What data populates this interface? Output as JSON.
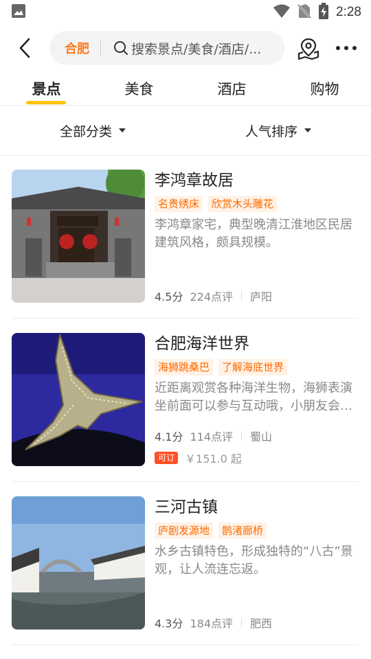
{
  "status_bar": {
    "time": "2:28"
  },
  "header": {
    "city": "合肥",
    "search_placeholder": "搜索景点/美食/酒店/..."
  },
  "tabs": [
    {
      "label": "景点",
      "active": true
    },
    {
      "label": "美食",
      "active": false
    },
    {
      "label": "酒店",
      "active": false
    },
    {
      "label": "购物",
      "active": false
    }
  ],
  "filters": {
    "category": "全部分类",
    "sort": "人气排序"
  },
  "items": [
    {
      "title": "李鸿章故居",
      "tags": [
        "名贵绣床",
        "欣赏木头雕花"
      ],
      "description": "李鸿章家宅，典型晚清江淮地区民居建筑风格，颇具规模。",
      "score": "4.5分",
      "reviews": "224点评",
      "district": "庐阳"
    },
    {
      "title": "合肥海洋世界",
      "tags": [
        "海狮跳桑巴",
        "了解海底世界"
      ],
      "description": "近距离观赏各种海洋生物，海狮表演坐前面可以参与互动哦，小朋友会很喜欢。",
      "score": "4.1分",
      "reviews": "114点评",
      "district": "蜀山",
      "badge": "可订",
      "price": "￥151.0 起"
    },
    {
      "title": "三河古镇",
      "tags": [
        "庐剧发源地",
        "鹊渚廊桥"
      ],
      "description": "水乡古镇特色，形成独特的“八古”景观，让人流连忘返。",
      "score": "4.3分",
      "reviews": "184点评",
      "district": "肥西"
    }
  ]
}
